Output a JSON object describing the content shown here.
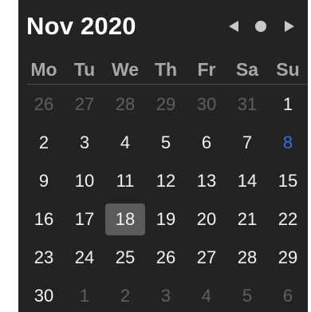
{
  "calendar": {
    "title": "Nov 2020",
    "weekdays": [
      "Mo",
      "Tu",
      "We",
      "Th",
      "Fr",
      "Sa",
      "Su"
    ],
    "weeks": [
      [
        "26",
        "27",
        "28",
        "29",
        "30",
        "31",
        "1"
      ],
      [
        "2",
        "3",
        "4",
        "5",
        "6",
        "7",
        "8"
      ],
      [
        "9",
        "10",
        "11",
        "12",
        "13",
        "14",
        "15"
      ],
      [
        "16",
        "17",
        "18",
        "19",
        "20",
        "21",
        "22"
      ],
      [
        "23",
        "24",
        "25",
        "26",
        "27",
        "28",
        "29"
      ],
      [
        "30",
        "1",
        "2",
        "3",
        "4",
        "5",
        "6"
      ]
    ],
    "selected_day": "18",
    "today_marker_day": "8",
    "controls": {
      "prev_icon": "triangle-left-icon",
      "today_icon": "dot-icon",
      "next_icon": "triangle-right-icon"
    }
  },
  "colors": {
    "background": "#232323",
    "text": "#f1f1f1",
    "muted_text": "#5f5f5f",
    "weekday_text": "#a7a7a7",
    "selected_fill": "#5b5b5b",
    "highlight_blue": "#2f6fe8"
  }
}
